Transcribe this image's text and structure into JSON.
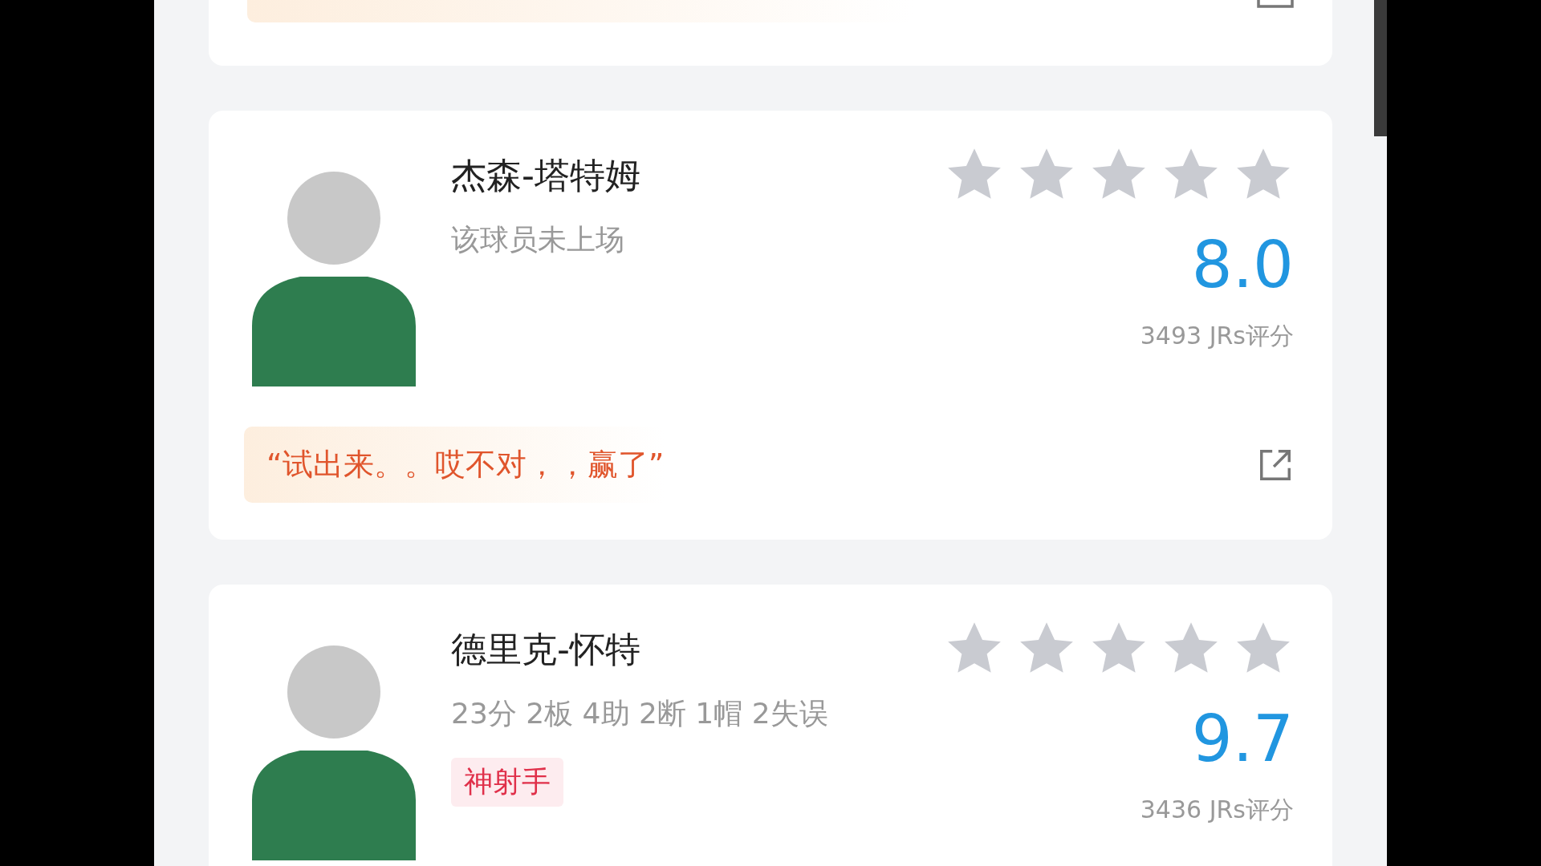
{
  "players": [
    {
      "name": "杰森-塔特姆",
      "subtitle": "该球员未上场",
      "stars": 0,
      "score": "8.0",
      "count": "3493 JRs评分",
      "quote": "“试出来。。哎不对，，赢了”"
    },
    {
      "name": "德里克-怀特",
      "subtitle": "23分 2板 4助 2断 1帽 2失误",
      "tag": "神射手",
      "stars": 0,
      "score": "9.7",
      "count": "3436 JRs评分"
    }
  ]
}
